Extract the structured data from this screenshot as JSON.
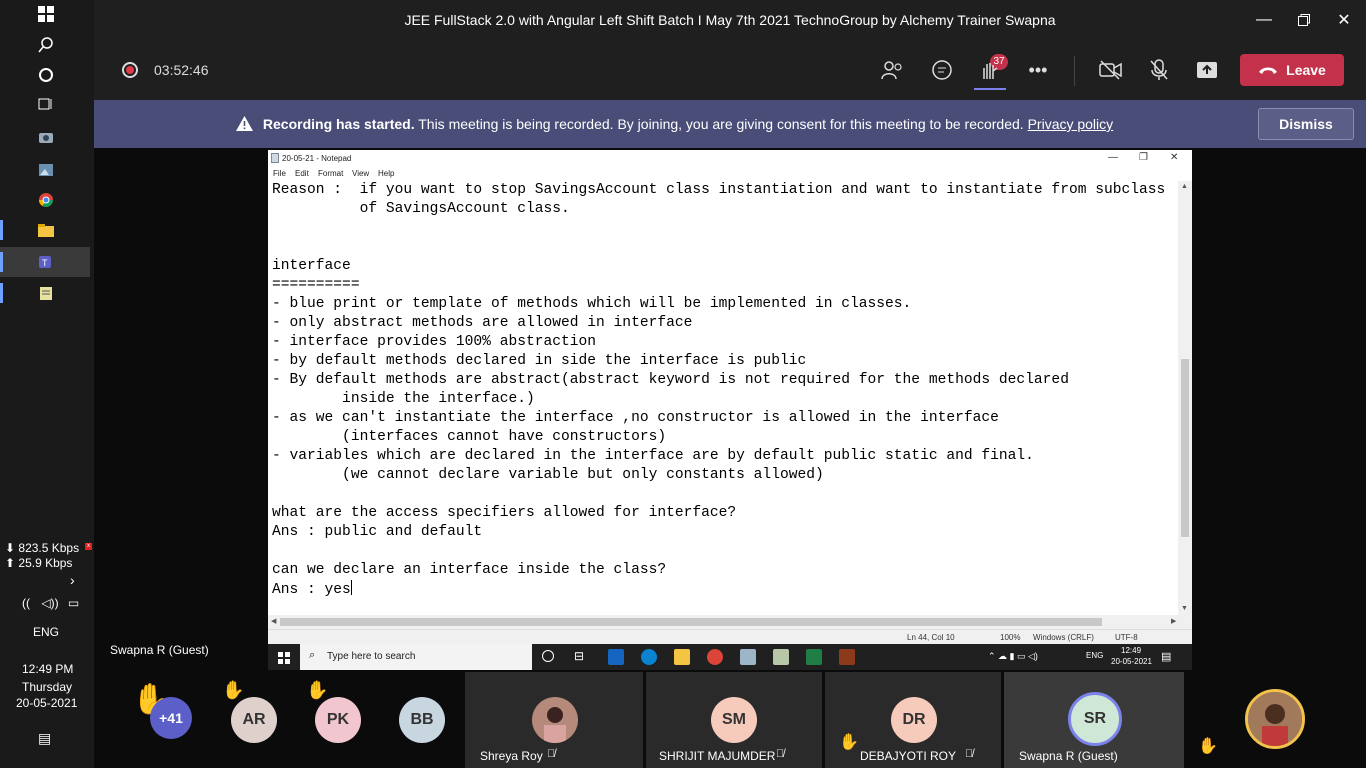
{
  "window": {
    "title": "JEE FullStack 2.0 with Angular Left Shift Batch I May 7th 2021 TechnoGroup by Alchemy Trainer Swapna"
  },
  "meeting": {
    "timer": "03:52:46",
    "participant_count": "37",
    "leave_label": "Leave"
  },
  "banner": {
    "bold": "Recording has started.",
    "text": "This meeting is being recorded. By joining, you are giving consent for this meeting to be recorded.",
    "link": "Privacy policy",
    "dismiss": "Dismiss"
  },
  "notepad": {
    "title": "20-05-21 - Notepad",
    "menu": [
      "File",
      "Edit",
      "Format",
      "View",
      "Help"
    ],
    "lines": [
      "Reason :  if you want to stop SavingsAccount class instantiation and want to instantiate from subclass",
      "          of SavingsAccount class.",
      "",
      "",
      "interface",
      "==========",
      "- blue print or template of methods which will be implemented in classes.",
      "- only abstract methods are allowed in interface",
      "- interface provides 100% abstraction",
      "- by default methods declared in side the interface is public",
      "- By default methods are abstract(abstract keyword is not required for the methods declared",
      "        inside the interface.)",
      "- as we can't instantiate the interface ,no constructor is allowed in the interface",
      "        (interfaces cannot have constructors)",
      "- variables which are declared in the interface are by default public static and final.",
      "        (we cannot declare variable but only constants allowed)",
      "",
      "what are the access specifiers allowed for interface?",
      "Ans : public and default",
      "",
      "can we declare an interface inside the class?",
      "Ans : yes"
    ],
    "status": {
      "position": "Ln 44, Col 10",
      "zoom": "100%",
      "line_ending": "Windows (CRLF)",
      "encoding": "UTF-8"
    },
    "inner_taskbar": {
      "search_placeholder": "Type here to search",
      "lang": "ENG",
      "time": "12:49",
      "date": "20-05-2021"
    }
  },
  "presenter": "Swapna R (Guest)",
  "left_taskbar": {
    "download": "823.5 Kbps",
    "upload": "25.9 Kbps",
    "lang": "ENG",
    "time": "12:49 PM",
    "day": "Thursday",
    "date": "20-05-2021"
  },
  "participants": {
    "overflow": "+41",
    "avatars": [
      {
        "initials": "AR",
        "color": "#e0d0cc"
      },
      {
        "initials": "PK",
        "color": "#f2c6cf"
      },
      {
        "initials": "BB",
        "color": "#c8d6e0"
      }
    ],
    "tiles": [
      {
        "name": "Shreya Roy"
      },
      {
        "name": "SHRIJIT MAJUMDER",
        "initials": "SM",
        "color": "#f6cbbb"
      },
      {
        "name": "DEBAJYOTI ROY",
        "initials": "DR",
        "color": "#f6cbbb"
      },
      {
        "name": "Swapna R (Guest)",
        "initials": "SR",
        "color": "#cfe7d6"
      }
    ]
  },
  "colors": {
    "accent": "#7b83eb",
    "leave": "#c4314b",
    "banner": "#4a4d78"
  }
}
